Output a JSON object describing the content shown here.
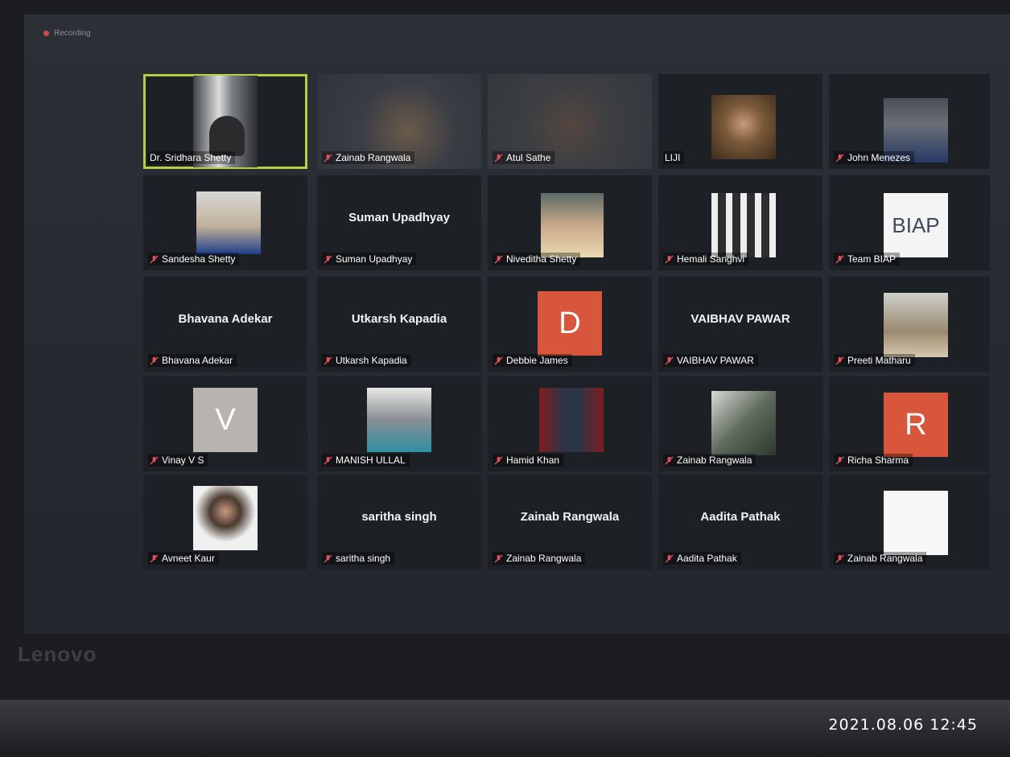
{
  "recording": {
    "label": "Recording"
  },
  "colors": {
    "active_border": "#b7cf45",
    "mic_muted": "#e0505a"
  },
  "participants": [
    {
      "name": "Dr. Sridhara  Shetty",
      "video": true,
      "active": true,
      "muted": false
    },
    {
      "name": "Zainab Rangwala",
      "video": true,
      "muted": true
    },
    {
      "name": "Atul Sathe",
      "video": true,
      "muted": true
    },
    {
      "name": "LIJI",
      "video": true,
      "muted": false
    },
    {
      "name": "John Menezes",
      "video": true,
      "muted": true
    },
    {
      "name": "Sandesha Shetty",
      "video": true,
      "muted": true
    },
    {
      "name": "Suman Upadhyay",
      "video": false,
      "display_name": "Suman Upadhyay",
      "muted": true
    },
    {
      "name": "Niveditha Shetty",
      "video": true,
      "muted": true
    },
    {
      "name": "Hemali Sanghvi",
      "video": true,
      "muted": true
    },
    {
      "name": "Team BIAP",
      "video": true,
      "logo_text": "BIAP",
      "muted": true
    },
    {
      "name": "Bhavana Adekar",
      "video": false,
      "display_name": "Bhavana Adekar",
      "muted": true
    },
    {
      "name": "Utkarsh Kapadia",
      "video": false,
      "display_name": "Utkarsh Kapadia",
      "muted": true
    },
    {
      "name": "Debbie James",
      "video": false,
      "avatar_letter": "D",
      "muted": true
    },
    {
      "name": "VAIBHAV PAWAR",
      "video": false,
      "display_name": "VAIBHAV PAWAR",
      "muted": true
    },
    {
      "name": "Preeti Matharu",
      "video": true,
      "muted": true
    },
    {
      "name": "Vinay V S",
      "video": false,
      "avatar_letter": "V",
      "muted": true
    },
    {
      "name": "MANISH ULLAL",
      "video": true,
      "muted": true
    },
    {
      "name": "Hamid Khan",
      "video": true,
      "muted": true
    },
    {
      "name": "Zainab Rangwala",
      "video": true,
      "muted": true
    },
    {
      "name": "Richa Sharma",
      "video": false,
      "avatar_letter": "R",
      "muted": true
    },
    {
      "name": "Avneet Kaur",
      "video": true,
      "muted": true
    },
    {
      "name": "saritha singh",
      "video": false,
      "display_name": "saritha singh",
      "muted": true
    },
    {
      "name": "Zainab Rangwala",
      "video": false,
      "display_name": "Zainab Rangwala",
      "muted": true
    },
    {
      "name": "Aadita Pathak",
      "video": false,
      "display_name": "Aadita Pathak",
      "muted": true
    },
    {
      "name": "Zainab Rangwala",
      "video": true,
      "muted": true
    }
  ],
  "bezel": {
    "brand": "Lenovo"
  },
  "photo_timestamp": "2021.08.06 12:45"
}
